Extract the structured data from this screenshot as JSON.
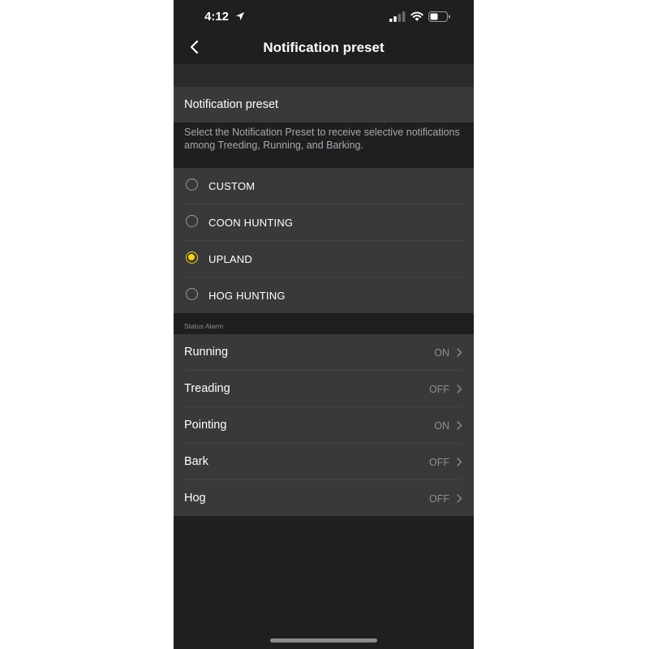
{
  "status_bar": {
    "time": "4:12"
  },
  "header": {
    "back_icon": "chevron-left-icon",
    "title": "Notification preset"
  },
  "section": {
    "title": "Notification preset",
    "description": "Select the Notification Preset to receive selective notifications among Treeding, Running, and Barking."
  },
  "presets": [
    {
      "label": "CUSTOM",
      "selected": false
    },
    {
      "label": "COON HUNTING",
      "selected": false
    },
    {
      "label": "UPLAND",
      "selected": true
    },
    {
      "label": "HOG HUNTING",
      "selected": false
    }
  ],
  "status_alarm": {
    "caption": "Status Alarm",
    "items": [
      {
        "label": "Running",
        "value": "ON"
      },
      {
        "label": "Treading",
        "value": "OFF"
      },
      {
        "label": "Pointing",
        "value": "ON"
      },
      {
        "label": "Bark",
        "value": "OFF"
      },
      {
        "label": "Hog",
        "value": "OFF"
      }
    ]
  },
  "colors": {
    "accent": "#f6d30b",
    "background": "#1f1f21",
    "row": "#39393b"
  }
}
